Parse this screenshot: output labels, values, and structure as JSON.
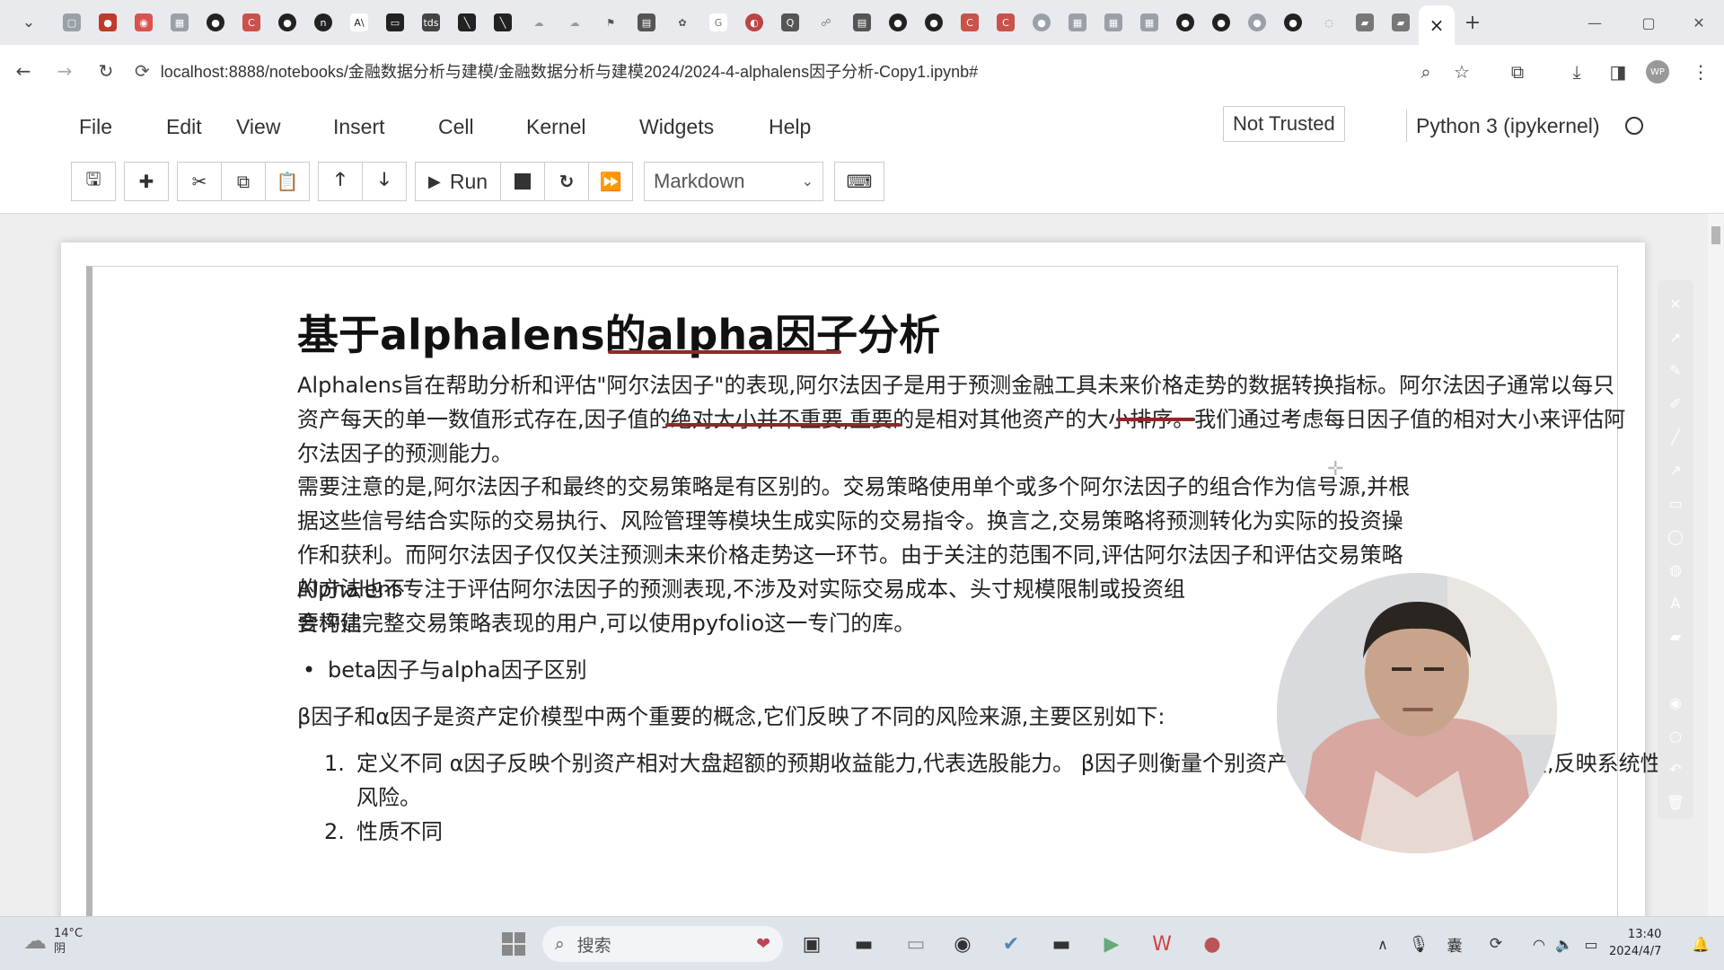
{
  "browser": {
    "url": "localhost:8888/notebooks/金融数据分析与建模/金融数据分析与建模2024/2024-4-alphalens因子分析-Copy1.ipynb#",
    "profile_badge": "WP",
    "tab_close": "×",
    "new_tab": "+"
  },
  "jupyter": {
    "menu": [
      "File",
      "Edit",
      "View",
      "Insert",
      "Cell",
      "Kernel",
      "Widgets",
      "Help"
    ],
    "trust_status": "Not Trusted",
    "kernel": "Python 3 (ipykernel)",
    "run_label": "Run",
    "cell_type": "Markdown"
  },
  "notebook": {
    "title": "基于alphalens的alpha因子分析",
    "paragraphs": [
      "Alphalens旨在帮助分析和评估\"阿尔法因子\"的表现,阿尔法因子是用于预测金融工具未来价格走势的数据转换指标。阿尔法因子通常以每只资产每天的单一数值形式存在,因子值的绝对大小并不重要,重要的是相对其他资产的大小排序。我们通过考虑每日因子值的相对大小来评估阿尔法因子的预测能力。",
      "需要注意的是,阿尔法因子和最终的交易策略是有区别的。交易策略使用单个或多个阿尔法因子的组合作为信号源,并根据这些信号结合实际的交易执行、风险管理等模块生成实际的交易指令。换言之,交易策略将预测转化为实际的投资操作和获利。而阿尔法因子仅仅关注预测未来价格走势这一环节。由于关注的范围不同,评估阿尔法因子和评估交易策略的方法也不",
      "Alphalens专注于评估阿尔法因子的预测表现,不涉及对实际交易成本、头寸规模限制或投资组合构建",
      "要评估完整交易策略表现的用户,可以使用pyfolio这一专门的库。"
    ],
    "paragraph3_tail": "需",
    "bullet": "beta因子与alpha因子区别",
    "intro": "β因子和α因子是资产定价模型中两个重要的概念,它们反映了不同的风险来源,主要区别如下:",
    "list": [
      {
        "num": "1.",
        "text": "定义不同 α因子反映个别资产相对大盘超额的预期收益能力,代表选股能力。 β因子则衡量个别资产受整体市场波动影响的程度,反映系统性风险。"
      },
      {
        "num": "2.",
        "text": "性质不同"
      }
    ]
  },
  "taskbar": {
    "temperature": "14°C",
    "weather": "阴",
    "search_placeholder": "搜索",
    "time": "13:40",
    "date": "2024/4/7"
  },
  "colors": {
    "annotation": "#8b2a2a",
    "cell_border": "#b6b6b6"
  }
}
